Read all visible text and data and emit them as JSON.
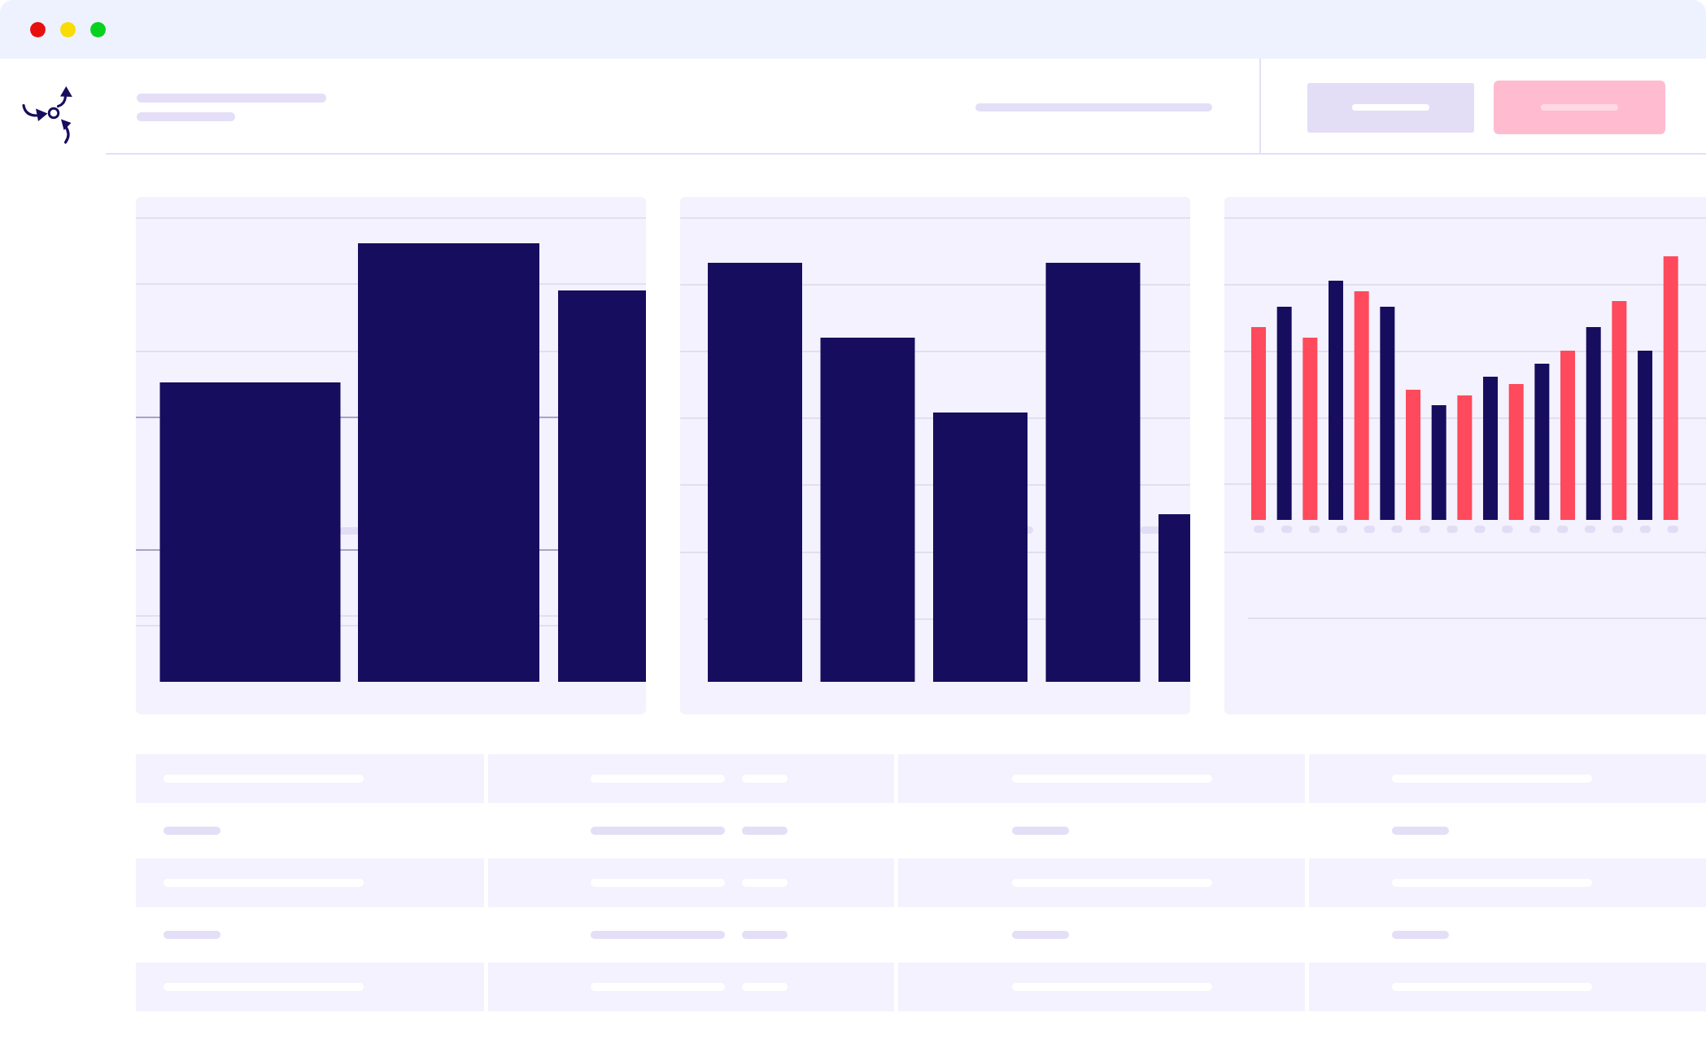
{
  "window": {
    "controls": [
      {
        "color": "#e80f0f"
      },
      {
        "color": "#f8dc04"
      },
      {
        "color": "#08d11f"
      }
    ]
  },
  "toolbar": {
    "buttons": [
      {
        "kind": "secondary"
      },
      {
        "kind": "primary"
      }
    ]
  },
  "table": {
    "rows": [
      {
        "kind": "shaded"
      },
      {
        "kind": "plain"
      },
      {
        "kind": "shaded"
      },
      {
        "kind": "plain"
      },
      {
        "kind": "shaded"
      }
    ]
  }
}
